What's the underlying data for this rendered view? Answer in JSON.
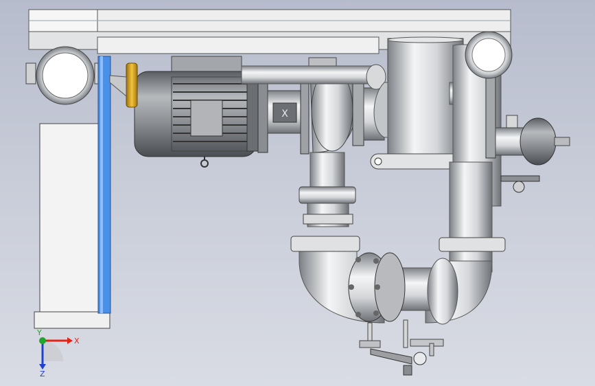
{
  "viewport": {
    "background_top": "#b7bccd",
    "background_bottom": "#d9dce4"
  },
  "colors": {
    "steel": "#c9ccd0",
    "steel_dark": "#6f7378",
    "motor": "#8e9196",
    "accent_blue": "#4a8fe8",
    "coupling_gold": "#d9a21c",
    "frame_white": "#ededed",
    "axis_x": "#e2231a",
    "axis_y": "#21a52a",
    "axis_z": "#2140d0"
  },
  "icons": {
    "motor": "electric-motor-icon",
    "pump": "centrifugal-pump-icon",
    "valve": "butterfly-valve-icon",
    "gauge": "pressure-gauge-icon"
  },
  "triad": {
    "x_label": "X",
    "y_label": "Y",
    "z_label": "Z"
  },
  "motor_plate": {
    "mark": "X"
  }
}
